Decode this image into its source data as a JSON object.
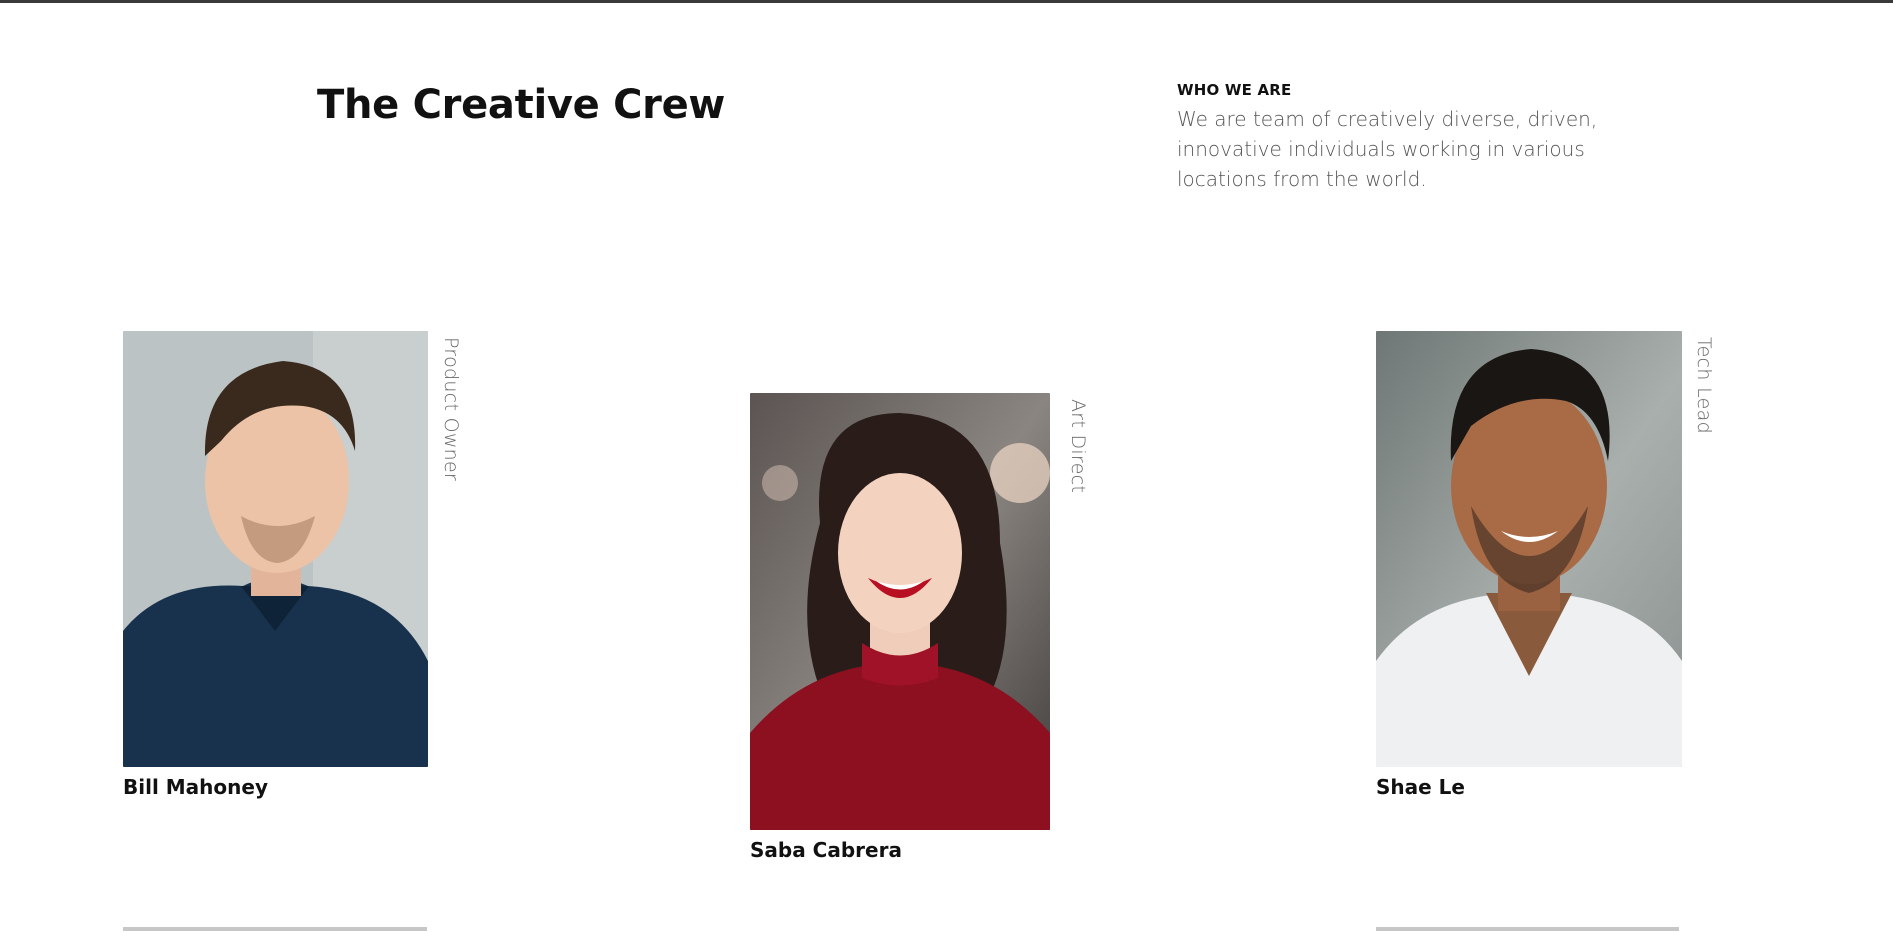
{
  "section": {
    "title": "The Creative Crew",
    "kicker": "WHO WE ARE",
    "description": "We are team of creatively diverse, driven, innovative individuals working in various locations from the world."
  },
  "team": [
    {
      "name": "Bill Mahoney",
      "role": "Product Owner"
    },
    {
      "name": "Saba Cabrera",
      "role": "Art Direct"
    },
    {
      "name": "Shae Le",
      "role": "Tech Lead"
    }
  ]
}
